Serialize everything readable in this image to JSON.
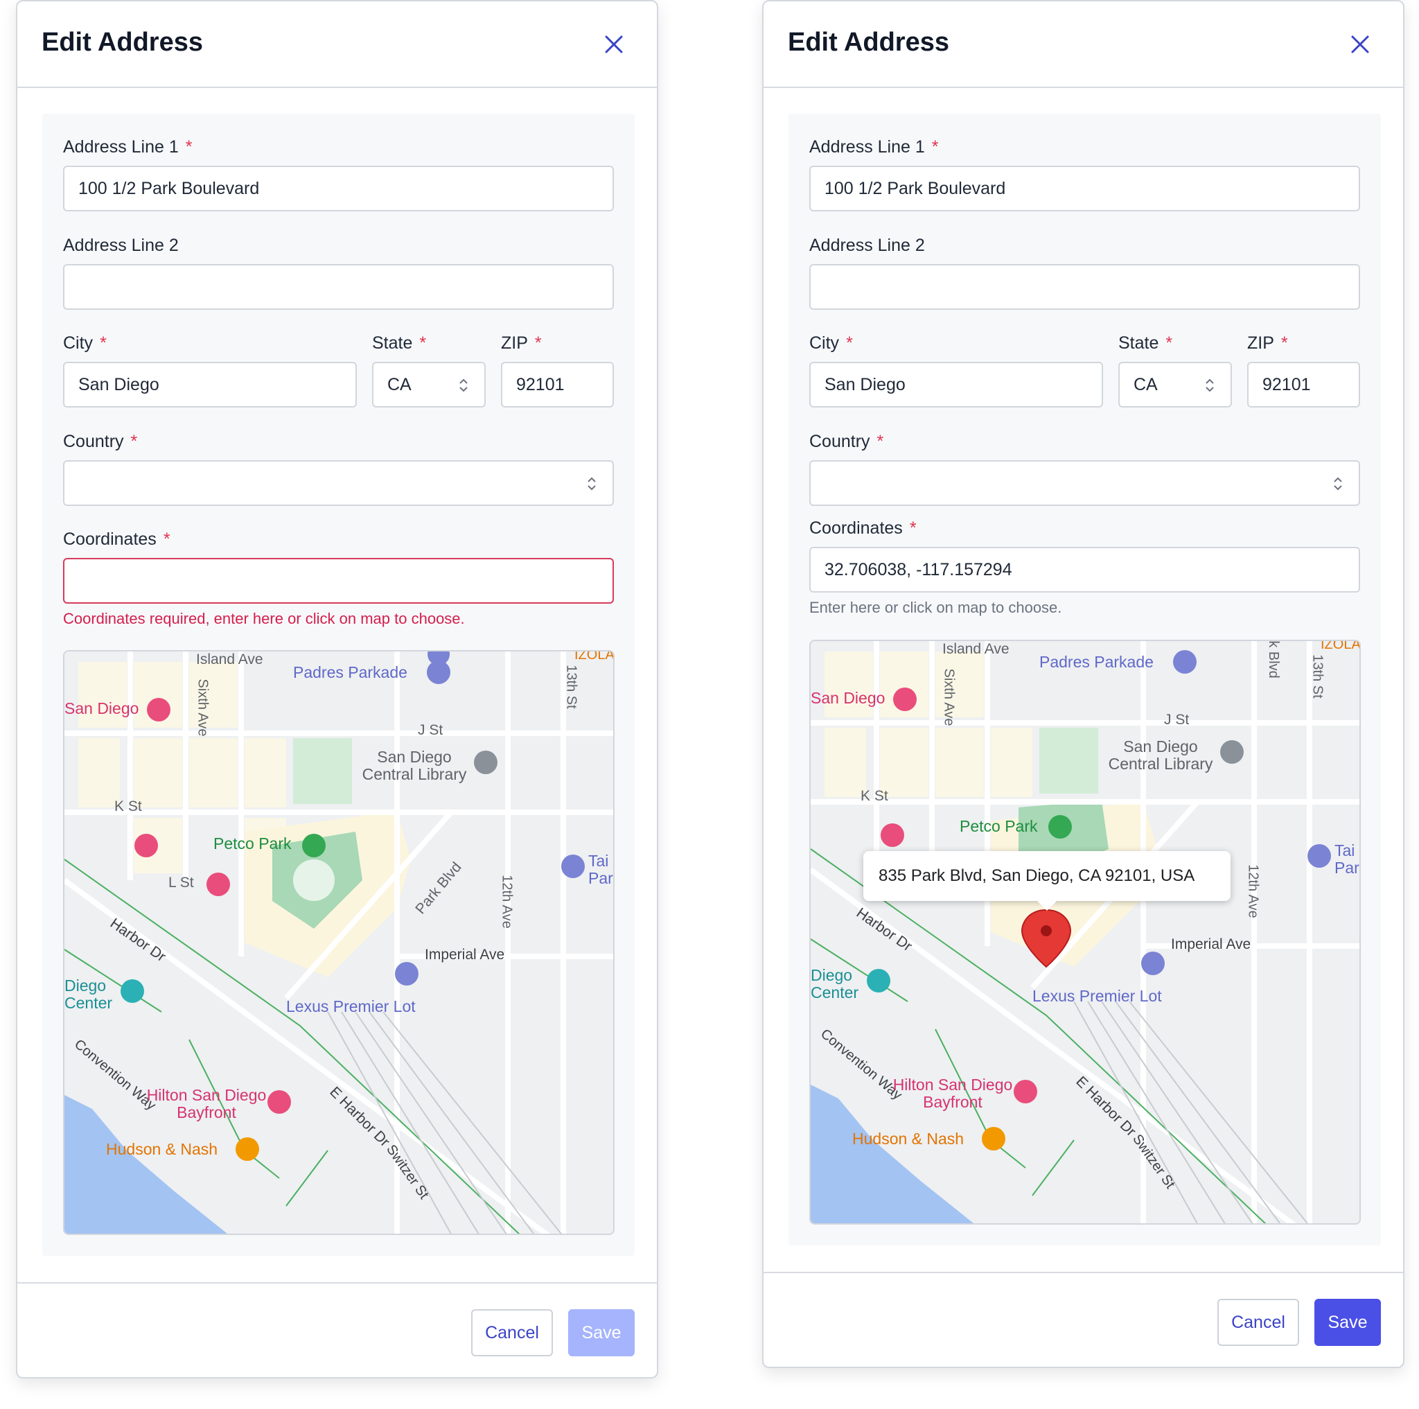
{
  "colors": {
    "accent": "#3b44c5",
    "save_enabled": "#4a4fe6",
    "save_disabled": "#a5b4fc",
    "error": "#d31f4c",
    "required": "#e0344f"
  },
  "dialogs": [
    {
      "title": "Edit Address",
      "form": {
        "address_line1": {
          "label": "Address Line 1",
          "required_mark": "*",
          "value": "100 1/2 Park Boulevard"
        },
        "address_line2": {
          "label": "Address Line 2",
          "value": ""
        },
        "city": {
          "label": "City",
          "required_mark": "*",
          "value": "San Diego"
        },
        "state": {
          "label": "State",
          "required_mark": "*",
          "value": "CA"
        },
        "zip": {
          "label": "ZIP",
          "required_mark": "*",
          "value": "92101"
        },
        "country": {
          "label": "Country",
          "required_mark": "*",
          "value": ""
        },
        "coordinates": {
          "label": "Coordinates",
          "required_mark": "*",
          "value": "",
          "state": "error",
          "message": "Coordinates required, enter here or click on map to choose."
        }
      },
      "map": {
        "streets": [
          "Island Ave",
          "Sixth Ave",
          "J St",
          "K St",
          "L St",
          "Park Blvd",
          "13th St",
          "12th Ave",
          "Imperial Ave",
          "Harbor Dr",
          "E Harbor Dr",
          "Switzer St",
          "Convention Way"
        ],
        "pois": [
          "Padres Parkade",
          "San Diego",
          "San Diego Central Library",
          "Petco Park",
          "Tai Par",
          "Diego Center",
          "Lexus Premier Lot",
          "Hilton San Diego Bayfront",
          "Hudson & Nash",
          "IZOLA"
        ]
      },
      "footer": {
        "cancel_label": "Cancel",
        "save_label": "Save",
        "save_enabled": false
      }
    },
    {
      "title": "Edit Address",
      "form": {
        "address_line1": {
          "label": "Address Line 1",
          "required_mark": "*",
          "value": "100 1/2 Park Boulevard"
        },
        "address_line2": {
          "label": "Address Line 2",
          "value": ""
        },
        "city": {
          "label": "City",
          "required_mark": "*",
          "value": "San Diego"
        },
        "state": {
          "label": "State",
          "required_mark": "*",
          "value": "CA"
        },
        "zip": {
          "label": "ZIP",
          "required_mark": "*",
          "value": "92101"
        },
        "country": {
          "label": "Country",
          "required_mark": "*",
          "value": ""
        },
        "coordinates": {
          "label": "Coordinates",
          "required_mark": "*",
          "value": "32.706038, -117.157294",
          "state": "valid",
          "message": "Enter here or click on map to choose."
        }
      },
      "map": {
        "streets": [
          "Island Ave",
          "Sixth Ave",
          "J St",
          "K St",
          "Park Blvd",
          "13th St",
          "12th Ave",
          "Imperial Ave",
          "Harbor Dr",
          "E Harbor Dr",
          "Switzer St",
          "Convention Way"
        ],
        "pois": [
          "Padres Parkade",
          "San Diego",
          "San Diego Central Library",
          "Petco Park",
          "Tai Par",
          "Diego Center",
          "Lexus Premier Lot",
          "Hilton San Diego Bayfront",
          "Hudson & Nash",
          "IZOLA"
        ],
        "marker_popup": "835 Park Blvd, San Diego, CA 92101, USA"
      },
      "footer": {
        "cancel_label": "Cancel",
        "save_label": "Save",
        "save_enabled": true
      }
    }
  ]
}
